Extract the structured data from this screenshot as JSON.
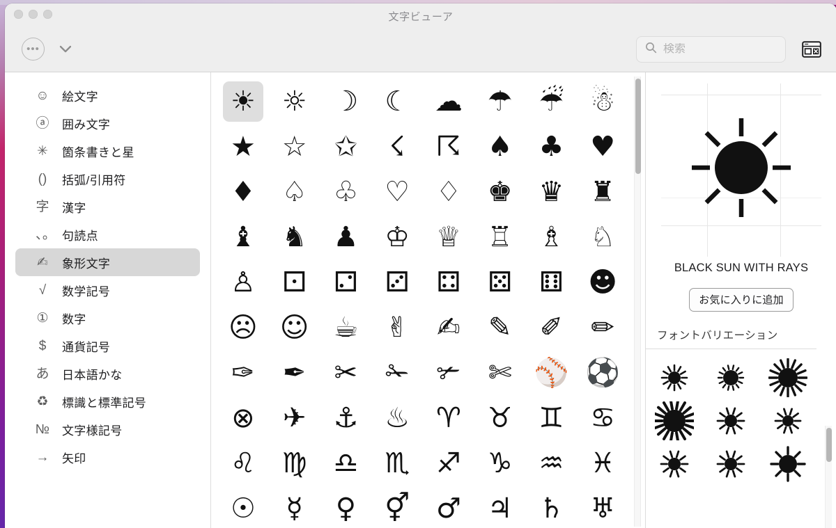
{
  "window": {
    "title": "文字ビューア",
    "traffic_lights": [
      "close",
      "minimize",
      "zoom"
    ]
  },
  "toolbar": {
    "more_button_label": "•••",
    "more_icon": "ellipsis-circle-icon",
    "chevron_icon": "chevron-down-icon",
    "search_icon": "search-icon",
    "search_placeholder": "検索",
    "search_value": "",
    "panel_toggle_icon": "keyboard-panel-icon"
  },
  "sidebar": {
    "selected_index": 6,
    "items": [
      {
        "icon": "☺",
        "icon_name": "smiley-icon",
        "label": "絵文字"
      },
      {
        "icon": "ⓐ",
        "icon_name": "circled-a-icon",
        "label": "囲み文字"
      },
      {
        "icon": "✳",
        "icon_name": "asterisk-icon",
        "label": "箇条書きと星"
      },
      {
        "icon": "()",
        "icon_name": "parentheses-icon",
        "label": "括弧/引用符"
      },
      {
        "icon": "字",
        "icon_name": "kanji-icon",
        "label": "漢字"
      },
      {
        "icon": "､｡",
        "icon_name": "punctuation-icon",
        "label": "句読点"
      },
      {
        "icon": "✍",
        "icon_name": "pictograph-icon",
        "label": "象形文字"
      },
      {
        "icon": "√",
        "icon_name": "radical-icon",
        "label": "数学記号"
      },
      {
        "icon": "①",
        "icon_name": "circled-one-icon",
        "label": "数字"
      },
      {
        "icon": "$",
        "icon_name": "dollar-icon",
        "label": "通貨記号"
      },
      {
        "icon": "あ",
        "icon_name": "hiragana-a-icon",
        "label": "日本語かな"
      },
      {
        "icon": "♻",
        "icon_name": "recycle-icon",
        "label": "標識と標準記号"
      },
      {
        "icon": "№",
        "icon_name": "numero-icon",
        "label": "文字様記号"
      },
      {
        "icon": "→",
        "icon_name": "arrow-right-icon",
        "label": "矢印"
      }
    ]
  },
  "grid": {
    "selected_index": 0,
    "columns": 8,
    "characters": [
      "☀",
      "☼",
      "☽",
      "☾",
      "☁",
      "☂",
      "☔",
      "☃",
      "★",
      "☆",
      "✩",
      "☇",
      "☈",
      "♠",
      "♣",
      "♥",
      "♦",
      "♤",
      "♧",
      "♡",
      "♢",
      "♚",
      "♛",
      "♜",
      "♝",
      "♞",
      "♟",
      "♔",
      "♕",
      "♖",
      "♗",
      "♘",
      "♙",
      "⚀",
      "⚁",
      "⚂",
      "⚃",
      "⚄",
      "⚅",
      "☻",
      "☹",
      "☺",
      "☕",
      "✌",
      "✍",
      "✎",
      "✐",
      "✏",
      "✑",
      "✒",
      "✂",
      "✁",
      "✃",
      "✄",
      "⚾",
      "⚽",
      "⊗",
      "✈",
      "⚓",
      "♨",
      "♈",
      "♉",
      "♊",
      "♋",
      "♌",
      "♍",
      "♎",
      "♏",
      "♐",
      "♑",
      "♒",
      "♓",
      "☉",
      "☿",
      "♀",
      "⚥",
      "♂",
      "♃",
      "♄",
      "♅"
    ]
  },
  "detail": {
    "preview_character": "☀",
    "character_name": "BLACK SUN WITH RAYS",
    "favorite_button_label": "お気に入りに追加",
    "variations_header": "フォントバリエーション",
    "variation_count": 9
  },
  "colors": {
    "toolbar_bg": "#eeeeee",
    "selection_bg": "#d7d7d7",
    "cell_selection_bg": "#dedede",
    "divider": "#dcdcdc",
    "title_text": "#8a8a8e",
    "body_text": "#1d1d1f",
    "scrollbar_thumb": "#b6b6b6"
  }
}
